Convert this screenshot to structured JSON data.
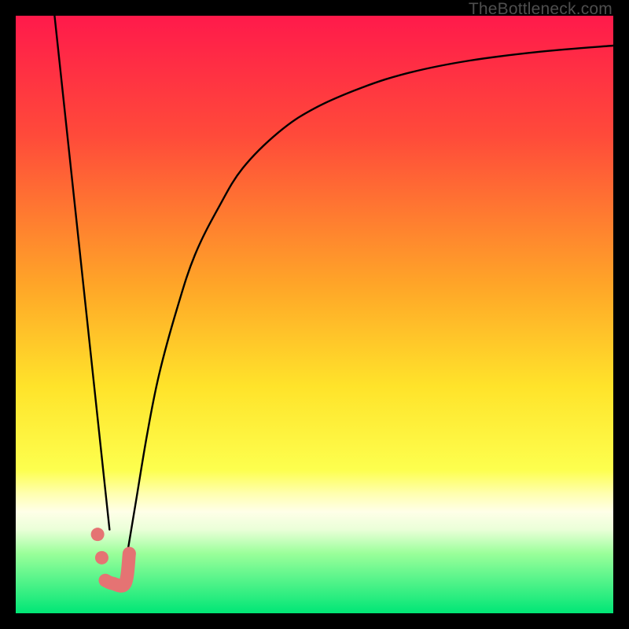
{
  "watermark": "TheBottleneck.com",
  "chart_data": {
    "type": "line",
    "title": "",
    "xlabel": "",
    "ylabel": "",
    "xlim": [
      0,
      100
    ],
    "ylim": [
      0,
      100
    ],
    "gradient_stops": [
      {
        "offset": 0,
        "color": "#ff1a4b"
      },
      {
        "offset": 20,
        "color": "#ff4a3a"
      },
      {
        "offset": 45,
        "color": "#ffa528"
      },
      {
        "offset": 62,
        "color": "#ffe32a"
      },
      {
        "offset": 76,
        "color": "#fdff4e"
      },
      {
        "offset": 80,
        "color": "#ffffb0"
      },
      {
        "offset": 83,
        "color": "#ffffe8"
      },
      {
        "offset": 86,
        "color": "#eaffd8"
      },
      {
        "offset": 90,
        "color": "#9aff9a"
      },
      {
        "offset": 100,
        "color": "#00e676"
      }
    ],
    "series": [
      {
        "name": "left-descent",
        "type": "line",
        "color": "#000000",
        "width": 2.4,
        "points": [
          {
            "x": 6.5,
            "y": 100
          },
          {
            "x": 15.7,
            "y": 14
          }
        ]
      },
      {
        "name": "right-curve",
        "type": "line",
        "color": "#000000",
        "width": 2.4,
        "points": [
          {
            "x": 18.5,
            "y": 9.0
          },
          {
            "x": 20.0,
            "y": 18.0
          },
          {
            "x": 22.0,
            "y": 30.0
          },
          {
            "x": 24.0,
            "y": 40.0
          },
          {
            "x": 27.0,
            "y": 51.0
          },
          {
            "x": 30.0,
            "y": 60.0
          },
          {
            "x": 34.0,
            "y": 68.0
          },
          {
            "x": 38.0,
            "y": 74.5
          },
          {
            "x": 44.0,
            "y": 80.5
          },
          {
            "x": 50.0,
            "y": 84.5
          },
          {
            "x": 58.0,
            "y": 88.0
          },
          {
            "x": 66.0,
            "y": 90.5
          },
          {
            "x": 76.0,
            "y": 92.5
          },
          {
            "x": 88.0,
            "y": 94.0
          },
          {
            "x": 100.0,
            "y": 95.0
          }
        ]
      },
      {
        "name": "valley-marker",
        "type": "marker",
        "color": "#e57373",
        "stroke_width": 17,
        "dot_radius": 8.5,
        "path": [
          {
            "x": 15.0,
            "y": 5.5
          },
          {
            "x": 16.2,
            "y": 5.0
          },
          {
            "x": 18.3,
            "y": 5.0
          },
          {
            "x": 19.0,
            "y": 10.0
          }
        ],
        "dots": [
          {
            "x": 13.7,
            "y": 13.2
          },
          {
            "x": 14.4,
            "y": 9.3
          }
        ]
      }
    ]
  }
}
